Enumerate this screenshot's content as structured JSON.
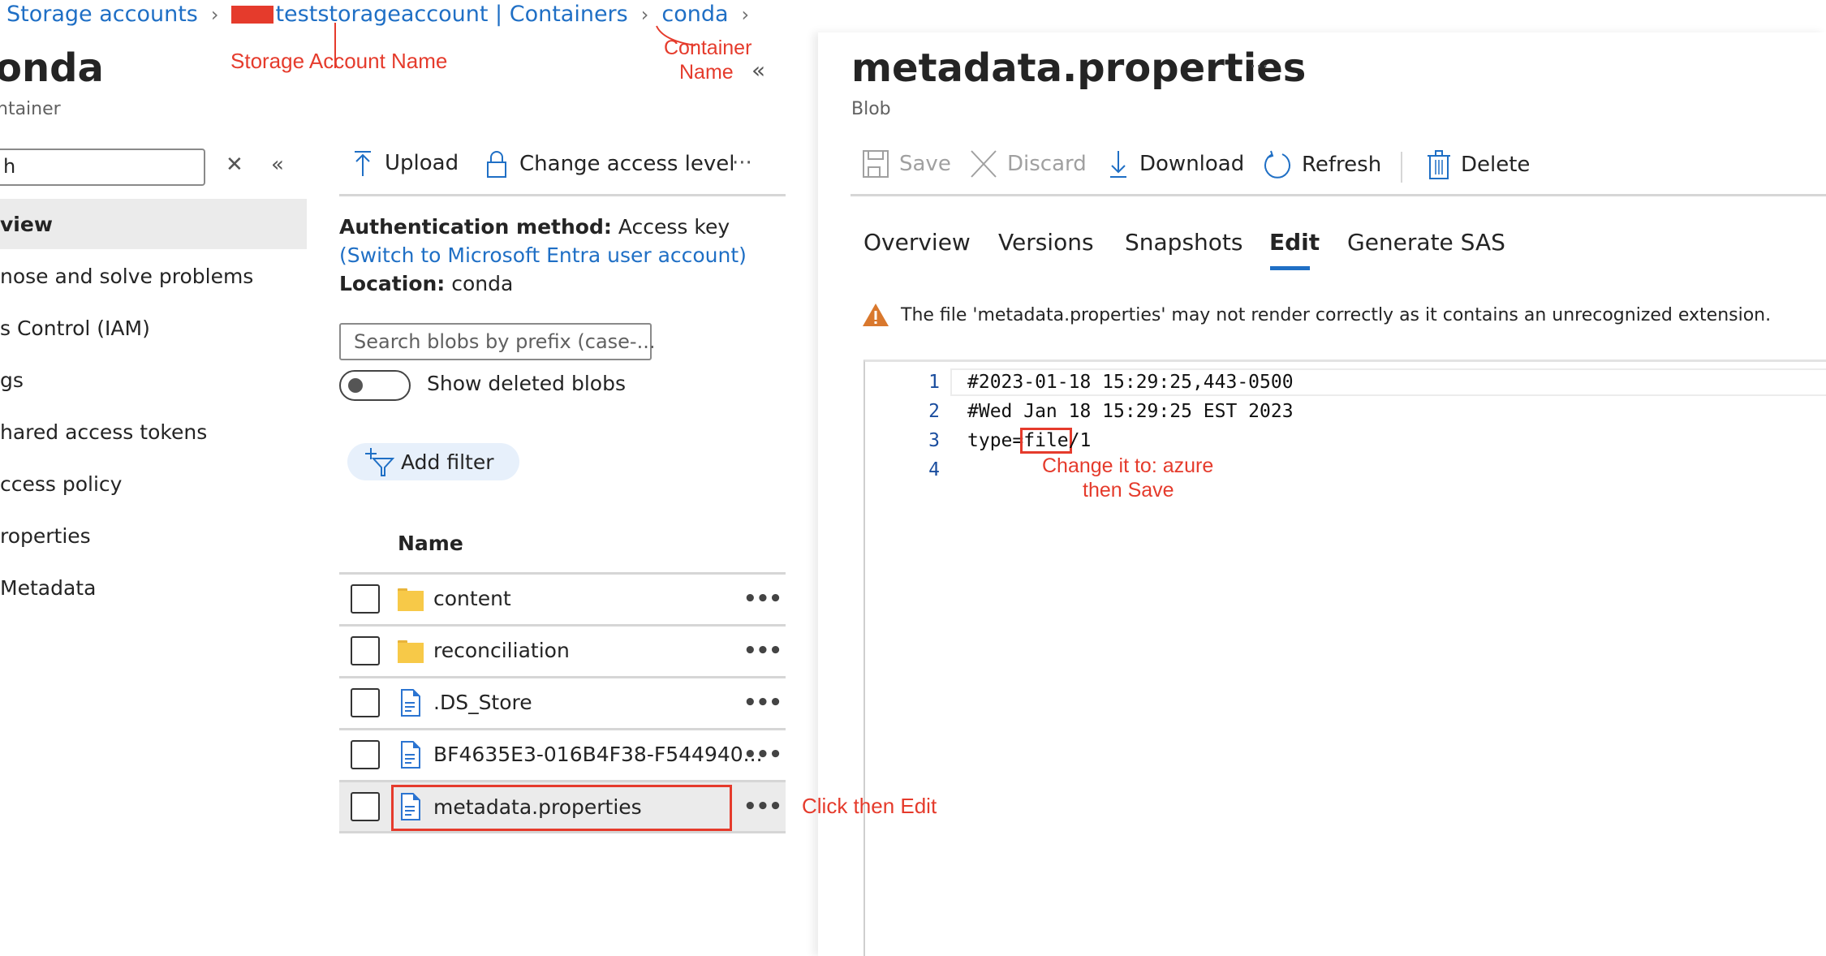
{
  "breadcrumb": {
    "items": [
      "Storage accounts",
      "teststorageaccount | Containers",
      "conda"
    ],
    "separator": ">"
  },
  "container": {
    "title": "onda",
    "subtitle": "ntainer"
  },
  "annotations": {
    "storage_account_name": "Storage Account Name",
    "container_name_line1": "Container",
    "container_name_line2": "Name",
    "click_then_edit": "Click then Edit",
    "change_line1": "Change it to: azure",
    "change_line2": "then Save"
  },
  "sidebar": {
    "search_value": "h",
    "clear_icon": "close-icon",
    "collapse_icon": "double-chevron-left-icon",
    "items": [
      {
        "label": "view",
        "active": true
      },
      {
        "label": "nose and solve problems",
        "active": false
      },
      {
        "label": "s Control (IAM)",
        "active": false
      },
      {
        "label": "gs",
        "active": false
      },
      {
        "label": "hared access tokens",
        "active": false
      },
      {
        "label": "ccess policy",
        "active": false
      },
      {
        "label": "roperties",
        "active": false
      },
      {
        "label": "Metadata",
        "active": false
      }
    ]
  },
  "middle": {
    "collapse_icon": "double-chevron-left-icon",
    "toolbar": {
      "upload": "Upload",
      "change_access": "Change access level",
      "more": "···"
    },
    "auth_label": "Authentication method:",
    "auth_value": "Access key",
    "auth_link": "(Switch to Microsoft Entra user account)",
    "location_label": "Location:",
    "location_value": "conda",
    "search_placeholder": "Search blobs by prefix (case-...",
    "show_deleted_label": "Show deleted blobs",
    "show_deleted_on": false,
    "add_filter": "Add filter",
    "column_name": "Name",
    "rows": [
      {
        "name": "content",
        "type": "folder",
        "selected": false
      },
      {
        "name": "reconciliation",
        "type": "folder",
        "selected": false
      },
      {
        "name": ".DS_Store",
        "type": "file",
        "selected": false
      },
      {
        "name": "BF4635E3-016B4F38-F544940...",
        "type": "file",
        "selected": false
      },
      {
        "name": "metadata.properties",
        "type": "file",
        "selected": true
      }
    ],
    "row_more": "•••"
  },
  "blob": {
    "title": "metadata.properties",
    "more": "···",
    "subtitle": "Blob",
    "toolbar": {
      "save": "Save",
      "discard": "Discard",
      "download": "Download",
      "refresh": "Refresh",
      "delete": "Delete"
    },
    "tabs": [
      {
        "label": "Overview",
        "active": false
      },
      {
        "label": "Versions",
        "active": false
      },
      {
        "label": "Snapshots",
        "active": false
      },
      {
        "label": "Edit",
        "active": true
      },
      {
        "label": "Generate SAS",
        "active": false
      }
    ],
    "warning": "The file 'metadata.properties' may not render correctly as it contains an unrecognized extension.",
    "editor_lines": [
      {
        "num": "1",
        "text": "#2023-01-18 15:29:25,443-0500"
      },
      {
        "num": "2",
        "text": "#Wed Jan 18 15:29:25 EST 2023"
      },
      {
        "num": "3",
        "prefix": "type=",
        "highlight": "file",
        "suffix": "/1"
      },
      {
        "num": "4",
        "text": ""
      }
    ]
  },
  "colors": {
    "accent": "#1f6fc5",
    "annotation": "#e53b2c",
    "warning": "#d9782d",
    "folder": "#f7c948",
    "selected_row": "#ebebeb"
  }
}
